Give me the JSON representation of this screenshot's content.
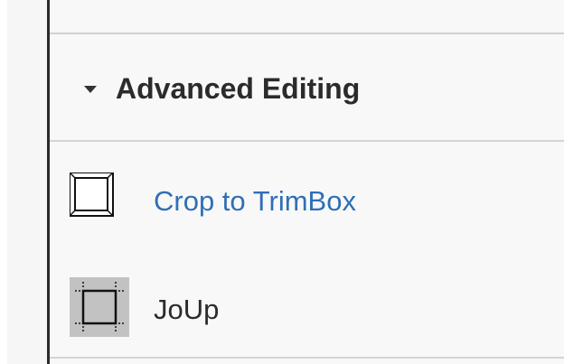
{
  "panel": {
    "section": {
      "title": "Advanced Editing",
      "expanded": true,
      "caret_icon": "triangle-down-icon"
    },
    "tools": [
      {
        "label": "Crop to TrimBox",
        "icon": "crop-box-icon",
        "label_color": "#2f6fb5"
      },
      {
        "label": "JoUp",
        "icon": "joup-icon",
        "label_color": "#2b2b2b"
      }
    ]
  }
}
